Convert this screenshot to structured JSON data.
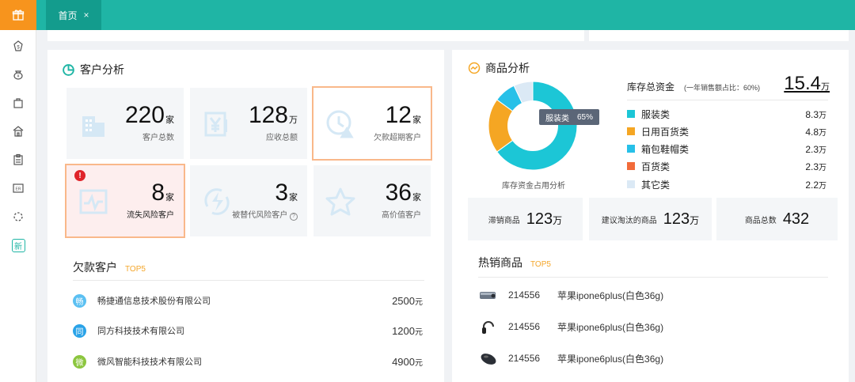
{
  "nav": {
    "tab_label": "首页",
    "tab_close": "×",
    "rail_items": [
      "gift-icon",
      "money-bag-icon",
      "coin-bag-icon",
      "shopping-bag-icon",
      "shop-icon",
      "clipboard-icon",
      "report-icon",
      "loading-icon",
      "new-badge-icon"
    ],
    "new_badge": "新"
  },
  "customer": {
    "title": "客户分析",
    "tiles": [
      {
        "value": "220",
        "unit": "家",
        "label": "客户总数"
      },
      {
        "value": "128",
        "unit": "万",
        "label": "应收总额"
      },
      {
        "value": "12",
        "unit": "家",
        "label": "欠款超期客户"
      },
      {
        "value": "8",
        "unit": "家",
        "label": "流失风险客户",
        "alert": "!"
      },
      {
        "value": "3",
        "unit": "家",
        "label": "被替代风险客户"
      },
      {
        "value": "36",
        "unit": "家",
        "label": "高价值客户"
      }
    ],
    "debt_title": "欠款客户",
    "debt_badge": "TOP5",
    "debtors": [
      {
        "initial": "畅",
        "name": "畅捷通信息技术股份有限公司",
        "amount": "2500",
        "unit": "元",
        "color": "#5bc0f2"
      },
      {
        "initial": "同",
        "name": "同方科技技术有限公司",
        "amount": "1200",
        "unit": "元",
        "color": "#2aa3e8"
      },
      {
        "initial": "微",
        "name": "微风智能科技技术有限公司",
        "amount": "4900",
        "unit": "元",
        "color": "#8cc63f"
      }
    ]
  },
  "product": {
    "title": "商品分析",
    "inventory_label": "库存总资金",
    "inventory_note": "(一年销售额占比：60%)",
    "inventory_value": "15.4",
    "inventory_unit": "万",
    "donut_caption": "库存资金占用分析",
    "tooltip_label": "服装类",
    "tooltip_value": "65%",
    "legend": [
      {
        "name": "服装类",
        "value": "8.3",
        "unit": "万",
        "color": "#1cc6d6"
      },
      {
        "name": "日用百货类",
        "value": "4.8",
        "unit": "万",
        "color": "#f5a623"
      },
      {
        "name": "箱包鞋帽类",
        "value": "2.3",
        "unit": "万",
        "color": "#27c0e8"
      },
      {
        "name": "百货类",
        "value": "2.3",
        "unit": "万",
        "color": "#f26b3a"
      },
      {
        "name": "其它类",
        "value": "2.2",
        "unit": "万",
        "color": "#dbe9f5"
      }
    ],
    "donut_shares": [
      65,
      20,
      8,
      0,
      7
    ],
    "stats": [
      {
        "label": "滞销商品",
        "value": "123",
        "unit": "万"
      },
      {
        "label": "建议淘汰的商品",
        "value": "123",
        "unit": "万"
      },
      {
        "label": "商品总数",
        "value": "432",
        "unit": ""
      }
    ],
    "hot_title": "热销商品",
    "hot_badge": "TOP5",
    "hot_items": [
      {
        "code": "214556",
        "name": "苹果ipone6plus(白色36g)",
        "pic": "projector-icon"
      },
      {
        "code": "214556",
        "name": "苹果ipone6plus(白色36g)",
        "pic": "headphones-icon"
      },
      {
        "code": "214556",
        "name": "苹果ipone6plus(白色36g)",
        "pic": "mouse-icon"
      }
    ]
  }
}
